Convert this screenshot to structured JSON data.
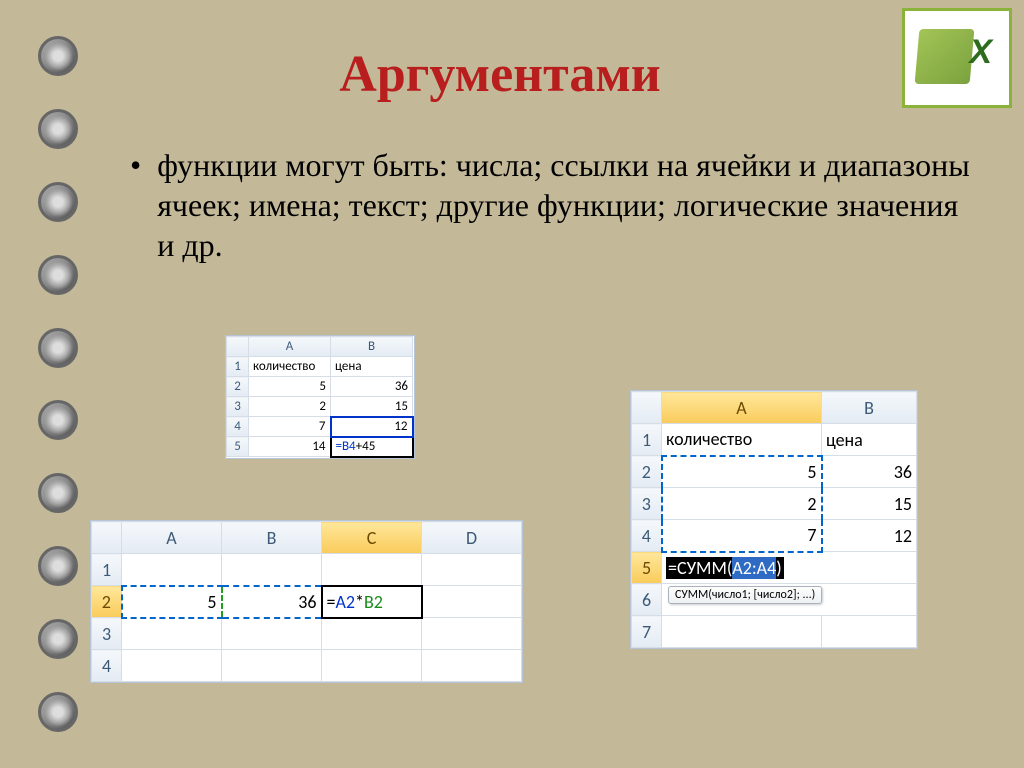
{
  "title": "Аргументами",
  "body": "функции могут быть: числа; ссылки на ячейки и диапазоны ячеек; имена; текст; другие функции; логические значения и др.",
  "grid1": {
    "cols": [
      "A",
      "B"
    ],
    "rows": [
      {
        "n": "1",
        "a": "количество",
        "b": "цена"
      },
      {
        "n": "2",
        "a": "5",
        "b": "36"
      },
      {
        "n": "3",
        "a": "2",
        "b": "15"
      },
      {
        "n": "4",
        "a": "7",
        "b": "12"
      },
      {
        "n": "5",
        "a": "14",
        "b_ref": "=B4",
        "b_plus": "+45"
      }
    ]
  },
  "grid2": {
    "cols": [
      "A",
      "B",
      "C",
      "D"
    ],
    "rows": [
      {
        "n": "1",
        "a": "",
        "b": "",
        "c": "",
        "d": ""
      },
      {
        "n": "2",
        "a": "5",
        "b": "36",
        "c_eq": "=",
        "c_ref1": "A2",
        "c_mid": "*",
        "c_ref2": "B2",
        "d": ""
      },
      {
        "n": "3"
      },
      {
        "n": "4"
      }
    ]
  },
  "grid3": {
    "cols": [
      "A",
      "B"
    ],
    "rows": [
      {
        "n": "1",
        "a": "количество",
        "b": "цена"
      },
      {
        "n": "2",
        "a": "5",
        "b": "36"
      },
      {
        "n": "3",
        "a": "2",
        "b": "15"
      },
      {
        "n": "4",
        "a": "7",
        "b": "12"
      },
      {
        "n": "5",
        "formula_pre": "=СУММ(",
        "formula_sel": "A2:A4",
        "formula_post": ")",
        "b": ""
      },
      {
        "n": "6",
        "tooltip": "СУММ(число1; [число2]; ...)"
      },
      {
        "n": "7"
      }
    ]
  }
}
